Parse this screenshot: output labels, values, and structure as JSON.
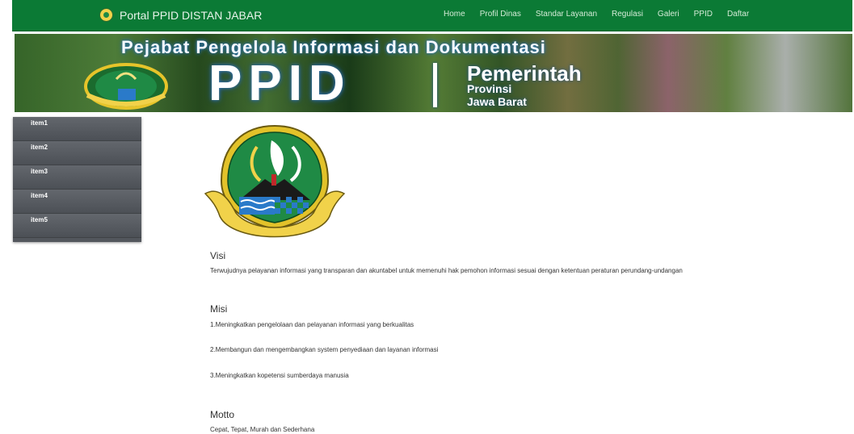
{
  "navbar": {
    "brand": "Portal PPID DISTAN JABAR",
    "menu": [
      "Home",
      "Profil Dinas",
      "Standar Layanan",
      "Regulasi",
      "Galeri",
      "PPID",
      "Daftar"
    ]
  },
  "banner": {
    "tagline": "Pejabat Pengelola Informasi dan Dokumentasi",
    "ppid": "PPID",
    "line1": "Pemerintah",
    "line2": "Provinsi",
    "line3": "Jawa Barat"
  },
  "sidebar": {
    "items": [
      "item1",
      "item2",
      "item3",
      "item4",
      "item5"
    ]
  },
  "emblem": {
    "motto": "GEMAH RIPAH REPEH RAPIH"
  },
  "content": {
    "visi_title": "Visi",
    "visi_text": "Terwujudnya pelayanan informasi yang transparan dan akuntabel untuk memenuhi hak pemohon informasi sesuai dengan ketentuan peraturan perundang-undangan",
    "misi_title": "Misi",
    "misi_items": [
      "1.Meningkatkan pengelolaan dan pelayanan informasi yang berkualitas",
      "2.Membangun dan mengembangkan system penyediaan dan layanan informasi",
      "3.Meningkatkan kopetensi sumberdaya manusia"
    ],
    "motto_title": "Motto",
    "motto_text": "Cepat, Tepat, Murah dan Sederhana"
  }
}
